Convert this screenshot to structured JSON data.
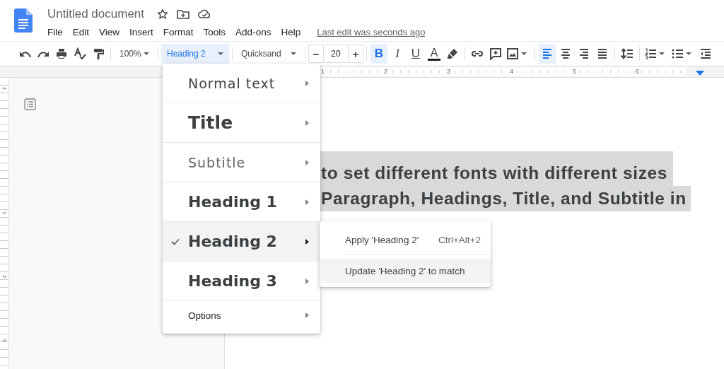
{
  "document": {
    "title": "Untitled document",
    "last_edit": "Last edit was seconds ago"
  },
  "menubar": [
    "File",
    "Edit",
    "View",
    "Insert",
    "Format",
    "Tools",
    "Add-ons",
    "Help"
  ],
  "toolbar": {
    "zoom": "100%",
    "style": "Heading 2",
    "style_open": true,
    "font": "Quicksand",
    "decrease": "−",
    "font_size": "20",
    "increase": "+",
    "format_buttons": [
      {
        "label": "B",
        "selected": true
      },
      {
        "label": "I",
        "selected": false
      },
      {
        "label": "U",
        "selected": false
      }
    ],
    "text_color_label": "A",
    "align_buttons": [
      {
        "selected": true
      },
      {
        "selected": false
      },
      {
        "selected": false
      },
      {
        "selected": false
      }
    ]
  },
  "ruler": {
    "labels": [
      "1",
      "2",
      "3",
      "4",
      "5",
      "6"
    ],
    "vertical_labels": [
      "1",
      "1",
      "2",
      "3"
    ]
  },
  "style_menu": {
    "items": [
      {
        "label": "Normal text",
        "kind": "normal",
        "selected": false
      },
      {
        "label": "Title",
        "kind": "title",
        "selected": false
      },
      {
        "label": "Subtitle",
        "kind": "subtitle",
        "selected": false
      },
      {
        "label": "Heading 1",
        "kind": "heading",
        "selected": false
      },
      {
        "label": "Heading 2",
        "kind": "heading",
        "selected": true
      },
      {
        "label": "Heading 3",
        "kind": "heading",
        "selected": false
      },
      {
        "label": "Options",
        "kind": "options",
        "selected": false
      }
    ]
  },
  "submenu": {
    "items": [
      {
        "label": "Apply 'Heading 2'",
        "shortcut": "Ctrl+Alt+2",
        "selected": false
      },
      {
        "label": "Update 'Heading 2' to match",
        "selected": true
      }
    ]
  },
  "body": {
    "lines": [
      "to set different fonts with different sizes",
      "Paragraph, Headings, Title, and Subtitle in"
    ]
  }
}
